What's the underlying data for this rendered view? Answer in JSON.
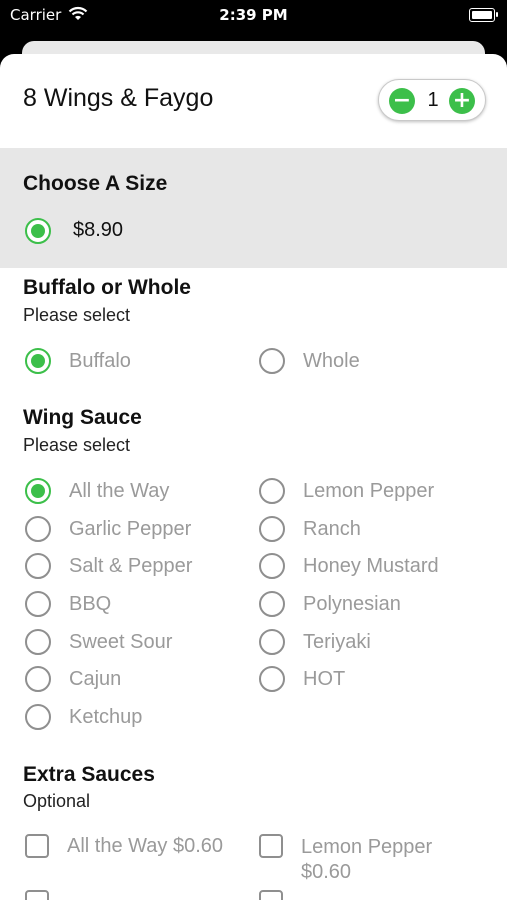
{
  "status_bar": {
    "carrier": "Carrier",
    "time": "2:39 PM"
  },
  "item": {
    "title": "8 Wings & Faygo",
    "quantity": "1"
  },
  "sections": {
    "size": {
      "title": "Choose A Size",
      "options": [
        {
          "label": "$8.90",
          "selected": true
        }
      ]
    },
    "buffalo": {
      "title": "Buffalo or Whole",
      "subtitle": "Please select",
      "options": [
        {
          "label": "Buffalo",
          "selected": true
        },
        {
          "label": "Whole",
          "selected": false
        }
      ]
    },
    "sauce": {
      "title": "Wing Sauce",
      "subtitle": "Please select",
      "options": [
        {
          "label": "All the Way",
          "selected": true
        },
        {
          "label": "Lemon Pepper",
          "selected": false
        },
        {
          "label": "Garlic Pepper",
          "selected": false
        },
        {
          "label": "Ranch",
          "selected": false
        },
        {
          "label": "Salt & Pepper",
          "selected": false
        },
        {
          "label": "Honey Mustard",
          "selected": false
        },
        {
          "label": "BBQ",
          "selected": false
        },
        {
          "label": "Polynesian",
          "selected": false
        },
        {
          "label": "Sweet Sour",
          "selected": false
        },
        {
          "label": "Teriyaki",
          "selected": false
        },
        {
          "label": "Cajun",
          "selected": false
        },
        {
          "label": "HOT",
          "selected": false
        },
        {
          "label": "Ketchup",
          "selected": false
        }
      ]
    },
    "extra": {
      "title": "Extra Sauces",
      "subtitle": "Optional",
      "options": [
        {
          "label": "All the Way",
          "price": "$0.60"
        },
        {
          "label": "Lemon Pepper",
          "price": "$0.60"
        }
      ]
    }
  },
  "colors": {
    "accent": "#3cbf4a",
    "section_bg": "#e7e7e7"
  },
  "icons": {
    "wifi": "wifi-icon",
    "battery": "battery-icon",
    "minus": "minus-icon",
    "plus": "plus-icon"
  }
}
